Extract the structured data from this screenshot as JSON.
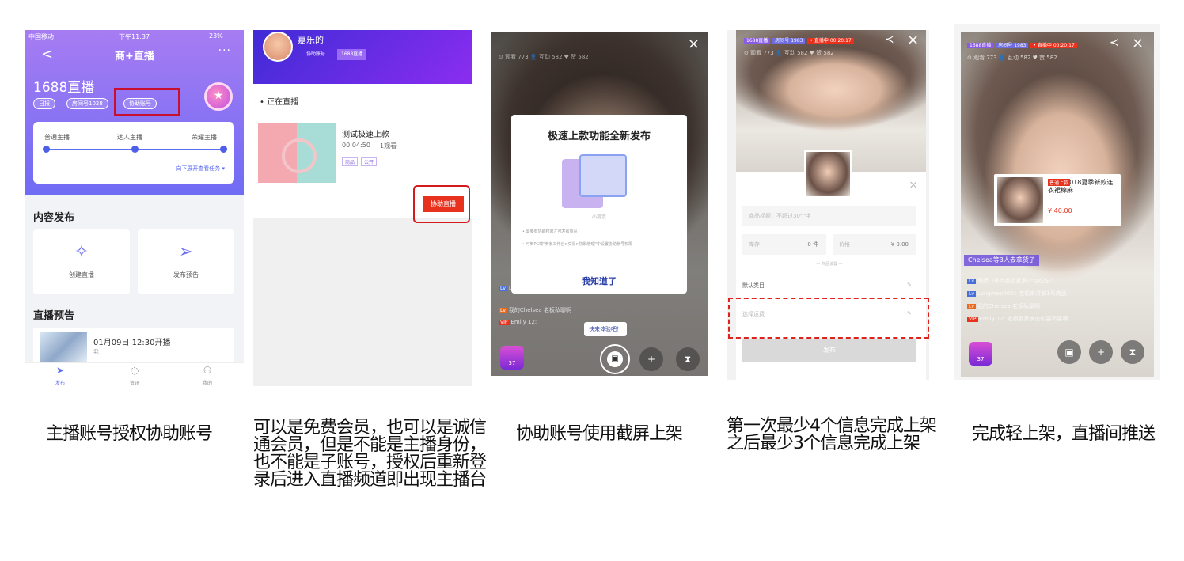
{
  "panel1": {
    "carrier": "中国移动",
    "time": "下午11:37",
    "battery": "23%",
    "back": "<",
    "title": "商+直播",
    "more": "···",
    "big_name": "1688直播",
    "tags": [
      "日报",
      "房间号1028",
      "协助账号"
    ],
    "levels": [
      "普通主播",
      "达人主播",
      "荣耀主播"
    ],
    "task_link": "向下展开查看任务 ▾",
    "section_publish": "内容发布",
    "create_live": "创建直播",
    "publish_preview": "发布预告",
    "section_preview": "直播预告",
    "preview_date": "01月09日 12:30开播",
    "preview_sub": "我",
    "tabs": [
      "发布",
      "资讯",
      "我的"
    ]
  },
  "panel2": {
    "name": "嘉乐的",
    "pill1": "协助账号",
    "pill2": "1688直播",
    "section": "• 正在直播",
    "item_title": "测试极速上款",
    "item_time": "00:04:50",
    "item_views": "1观看",
    "item_tags": [
      "商品",
      "公开"
    ],
    "assist_button": "协助直播"
  },
  "panel3": {
    "stats": "⊙ 观看 773   👤 互动 582   ♥ 赞 582",
    "dialog_title": "极速上款功能全新发布",
    "dialog_small": "小提示",
    "dialog_line1": "• 需要有协助权限才可发布商品",
    "dialog_line2": "• 可到PC端\"卖家工作台>交易>协助管理\"中设置协助账号权限",
    "dialog_button": "我知道了",
    "tip": "快来体验吧！",
    "gift_count": "37"
  },
  "panel4": {
    "topbar": [
      "1688直播",
      "房间号 1983",
      "• 直播中 00:20:17"
    ],
    "stats": "⊙ 观看 773   👤 互动 582   ♥ 赞 582",
    "title_placeholder": "商品标题，不超过30个字",
    "stock_label": "库存",
    "stock_value": "0 件",
    "price_label": "价格",
    "price_value": "¥ 0.00",
    "sep_text": "— 商品设置 —",
    "category": "默认类目",
    "shipping": "选择运费",
    "publish": "发布"
  },
  "panel5": {
    "topbar": [
      "1688直播",
      "房间号 1983",
      "• 直播中 00:20:17"
    ],
    "stats": "⊙ 观看 773   👤 互动 582   ♥ 赞 582",
    "card_tag": "普通上款",
    "card_title": "2018夏季新款连衣裙棉麻",
    "card_price": "¥ 40.00",
    "notice": "Chelsea等3人去拿货了",
    "chats": [
      "骄娇  3号商品起批多少包吃吃?",
      "Longmeo0001  老板来讲解1号商品",
      "我的Chelsea  老板私聊啊",
      "Emily 12:  老板我家水房你要不要啊"
    ],
    "gift_count": "37"
  },
  "captions": {
    "c1": "主播账号授权协助账号",
    "c2": "可以是免费会员，也可以是诚信\n通会员，但是不能是主播身份，\n也不能是子账号，授权后重新登\n录后进入直播频道即出现主播台",
    "c3": "协助账号使用截屏上架",
    "c4": "第一次最少4个信息完成上架\n之后最少3个信息完成上架",
    "c5": "完成轻上架，直播间推送"
  }
}
